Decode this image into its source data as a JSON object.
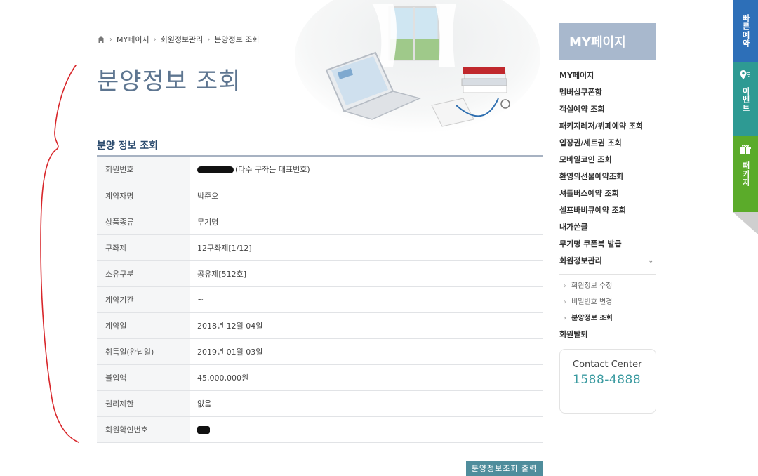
{
  "breadcrumb": {
    "items": [
      "MY페이지",
      "회원정보관리",
      "분양정보 조회"
    ]
  },
  "page": {
    "title": "분양정보 조회",
    "section_title": "분양 정보 조회"
  },
  "info_rows": [
    {
      "label": "회원번호",
      "value": "(다수 구좌는 대표번호)"
    },
    {
      "label": "계약자명",
      "value": "박준오"
    },
    {
      "label": "상품종류",
      "value": "무기명"
    },
    {
      "label": "구좌제",
      "value": "12구좌제[1/12]"
    },
    {
      "label": "소유구분",
      "value": "공유제[512호]"
    },
    {
      "label": "계약기간",
      "value": "~"
    },
    {
      "label": "계약일",
      "value": "2018년 12월 04일"
    },
    {
      "label": "취득일(완납일)",
      "value": "2019년 01월 03일"
    },
    {
      "label": "불입액",
      "value": "45,000,000원"
    },
    {
      "label": "권리제한",
      "value": "없음"
    },
    {
      "label": "회원확인번호",
      "value": ""
    }
  ],
  "print_button": "분양정보조회 출력",
  "sidebar": {
    "header": "MY페이지",
    "menu": [
      "MY페이지",
      "멤버십쿠폰함",
      "객실예약 조회",
      "패키지레저/뷔페예약 조회",
      "입장권/세트권 조회",
      "모바일코인 조회",
      "환영의선물예약조회",
      "셔틀버스예약 조회",
      "셀프바비큐예약 조회",
      "내가쓴글",
      "무기명 쿠폰북 발급",
      "회원정보관리"
    ],
    "submenu": [
      "회원정보 수정",
      "비밀번호 변경",
      "분양정보 조회"
    ],
    "menu_after": [
      "회원탈퇴"
    ],
    "contact_label": "Contact Center",
    "contact_phone": "1588-4888"
  },
  "quick_tabs": [
    {
      "label": "빠른예약",
      "icon": "calendar-icon",
      "color": "#2d6fb8"
    },
    {
      "label": "이벤트",
      "icon": "map-pin-icon",
      "color": "#2e9a93"
    },
    {
      "label": "패키지",
      "icon": "gift-icon",
      "color": "#5bab2a"
    }
  ],
  "colors": {
    "title": "#5d7590",
    "sidebar_header": "#a8b8cd",
    "button": "#4f8d9c",
    "phone": "#3a9aa0"
  }
}
